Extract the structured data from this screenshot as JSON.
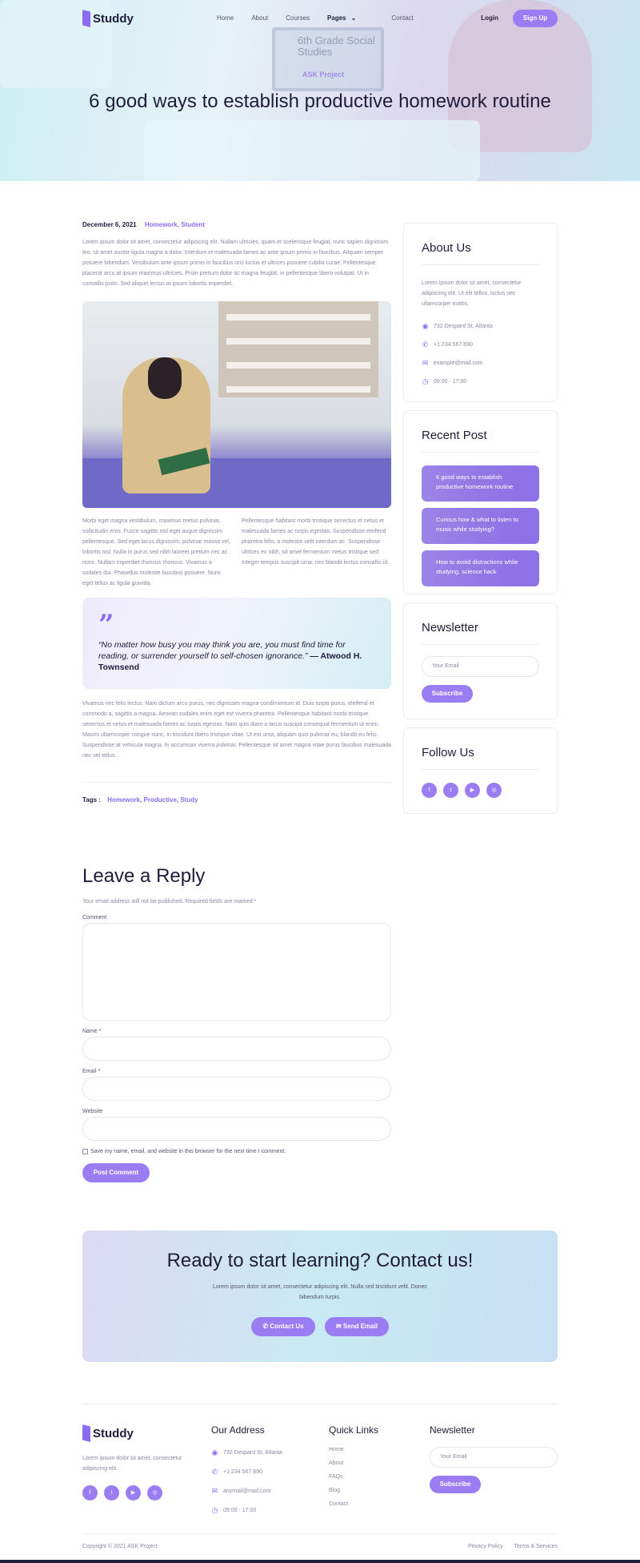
{
  "header": {
    "logo": "Studdy",
    "menu": [
      "Home",
      "About",
      "Courses",
      "Pages",
      "Contact"
    ],
    "login": "Login",
    "signup": "Sign Up",
    "hero_laptop_title": "6th Grade Social Studies",
    "hero_laptop_sub": "ASK Project",
    "title": "6 good ways to establish productive homework routine"
  },
  "article": {
    "date": "December 6, 2021",
    "categories": "Homework, Student",
    "intro": "Lorem ipsum dolor sit amet, consectetur adipiscing elit. Nullam ultricies, quam et scelerisque feugiat, nunc sapien dignissim leo, sit amet auctor ligula magna a dolor. Interdum et malesuada fames ac ante ipsum primis in faucibus. Aliquam semper posuere bibendum. Vestibulum ante ipsum primis in faucibus orci luctus et ultrices posuere cubilia curae; Pellentesque placerat arcu at ipsum maximus ultricies. Proin pretium dolor ac magna feugiat, in pellentesque libero volutpat. Ut in convallis justo. Sed aliquet lectus at ipsum lobortis imperdiet.",
    "col_left": "Morbi eget magna vestibulum, maximus metus pulvinar, sollicitudin eros. Fusce sagittis nisl eget augue dignissim pellentesque. Sed eget lacus dignissim, pulvinar massa vel, lobortis nisl. Nulla in purus sed nibh laoreet pretium nec ac nunc. Nullam imperdiet rhoncus rhoncus. Vivamus a sodales dui. Phasellus molestie faucibus posuere. Nunc eget tellus ac ligula gravida.",
    "col_right": "Pellentesque habitant morbi tristique senectus et netus et malesuada fames ac turpis egestas. Suspendisse eleifend pharetra felis, a molestie velit interdum ac. Suspendisse ultrices ex nibh, sit amet fermentum metus tristique sed. Integer tempus suscipit urna, nec blandit lectus convallis id.",
    "quote": "“No matter how busy you may think you are, you must find time for reading, or surrender yourself to self-chosen ignorance.”",
    "quote_author": "— Atwood H. Townsend",
    "outro": "Vivamus nec felis lectus. Nam dictum arcu purus, nec dignissim magna condimentum id. Duis turpis purus, eleifend et commodo a, sagittis a magna. Aenean sodales enim eget est viverra pharetra. Pellentesque habitant morbi tristique senectus et netus et malesuada fames ac turpis egestas. Nam quis diam a lacus suscipit consequat fermentum ut enim. Mauris ullamcorper congue nunc, in tincidunt libero tristique vitae. Ut est urna, aliquam quis pulvinar eu, blandit eu felis. Suspendisse at vehicula magna. In accumsan viverra pulvinar. Pellentesque sit amet magna vitae purus faucibus malesuada nec vel tellus.",
    "tags_label": "Tags :",
    "tags": "Homework, Productive, Study"
  },
  "sidebar": {
    "about_title": "About Us",
    "about_text": "Lorem ipsum dolor sit amet, consectetur adipiscing elit. Ut elit tellus, luctus nec ullamcorper mattis.",
    "address": "732 Despard St, Atlanta",
    "phone": "+1 234 567 890",
    "email": "example@mail.com",
    "hours": "09:00 - 17:00",
    "recent_title": "Recent Post",
    "recent_posts": [
      "6 good ways to establish productive homework routine",
      "Curious how & what to listen to music while studying?",
      "How to avoid distractions while studying, science hack"
    ],
    "newsletter_title": "Newsletter",
    "newsletter_placeholder": "Your Email",
    "subscribe": "Subscribe",
    "follow_title": "Follow Us"
  },
  "reply": {
    "title": "Leave a Reply",
    "note": "Your email address will not be published. Required fields are marked *",
    "comment_label": "Comment",
    "name_label": "Name *",
    "email_label": "Email *",
    "website_label": "Website",
    "save_label": "Save my name, email, and website in this browser for the next time I comment.",
    "post_button": "Post Comment"
  },
  "cta": {
    "title": "Ready to start learning? Contact us!",
    "text": "Lorem ipsum dolor sit amet, consectetur adipiscing elit. Nulla sed tincidunt velit. Donec bibendum turpis.",
    "contact_button": "Contact Us",
    "email_button": "Send Email"
  },
  "footer": {
    "logo": "Studdy",
    "about_text": "Lorem ipsum dolor sit amet, consectetur adipiscing elit.",
    "address_title": "Our Address",
    "address": "732 Despard St, Atlanta",
    "phone": "+1 234 567 890",
    "email": "anymail@mail.com",
    "hours": "09:00 - 17:00",
    "links_title": "Quick Links",
    "links": [
      "Home",
      "About",
      "FAQs",
      "Blog",
      "Contact"
    ],
    "newsletter_title": "Newsletter",
    "newsletter_placeholder": "Your Email",
    "subscribe": "Subscribe",
    "copyright": "Copyright © 2021 ASK Project",
    "privacy": "Privacy Policy",
    "terms": "Terms & Services"
  },
  "icons": {
    "social": [
      "facebook-icon",
      "twitter-icon",
      "youtube-icon",
      "instagram-icon"
    ]
  },
  "colors": {
    "accent": "#8b6cf0",
    "dark": "#1f1d3a"
  }
}
